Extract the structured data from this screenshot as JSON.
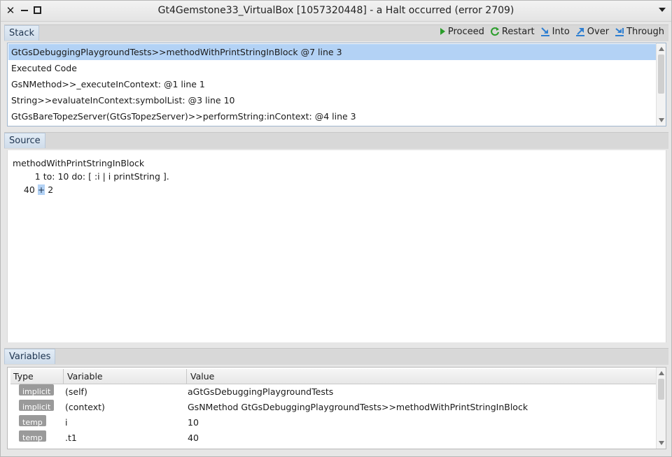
{
  "window": {
    "title": "Gt4Gemstone33_VirtualBox [1057320448] - a Halt occurred (error 2709)"
  },
  "stack": {
    "tab_label": "Stack",
    "toolbar": [
      {
        "label": "Proceed",
        "icon": "proceed-icon",
        "color": "#2a9d2a"
      },
      {
        "label": "Restart",
        "icon": "restart-icon",
        "color": "#2a9d2a"
      },
      {
        "label": "Into",
        "icon": "step-into-icon",
        "color": "#2f7fd1"
      },
      {
        "label": "Over",
        "icon": "step-over-icon",
        "color": "#2f7fd1"
      },
      {
        "label": "Through",
        "icon": "step-through-icon",
        "color": "#2f7fd1"
      }
    ],
    "frames": [
      "GtGsDebuggingPlaygroundTests>>methodWithPrintStringInBlock @7 line 3",
      "Executed Code",
      "GsNMethod>>_executeInContext: @1 line 1",
      "String>>evaluateInContext:symbolList: @3 line 10",
      "GtGsBareTopezServer(GtGsTopezServer)>>performString:inContext: @4 line 3"
    ],
    "selected_index": 0
  },
  "source": {
    "tab_label": "Source",
    "line1": "methodWithPrintStringInBlock",
    "line2": "        1 to: 10 do: [ :i | i printString ].",
    "line3_pre": "    40 ",
    "line3_hl": "+",
    "line3_post": " 2"
  },
  "variables": {
    "tab_label": "Variables",
    "columns": [
      "Type",
      "Variable",
      "Value"
    ],
    "rows": [
      {
        "type": "implicit",
        "variable": "(self)",
        "value": "aGtGsDebuggingPlaygroundTests"
      },
      {
        "type": "implicit",
        "variable": "(context)",
        "value": "GsNMethod GtGsDebuggingPlaygroundTests>>methodWithPrintStringInBlock"
      },
      {
        "type": "temp",
        "variable": "i",
        "value": "10"
      },
      {
        "type": "temp",
        "variable": ".t1",
        "value": "40"
      }
    ]
  },
  "colors": {
    "selection": "#b3d2f5",
    "tab_text": "#1f3550",
    "badge": "#9a9a9a"
  }
}
